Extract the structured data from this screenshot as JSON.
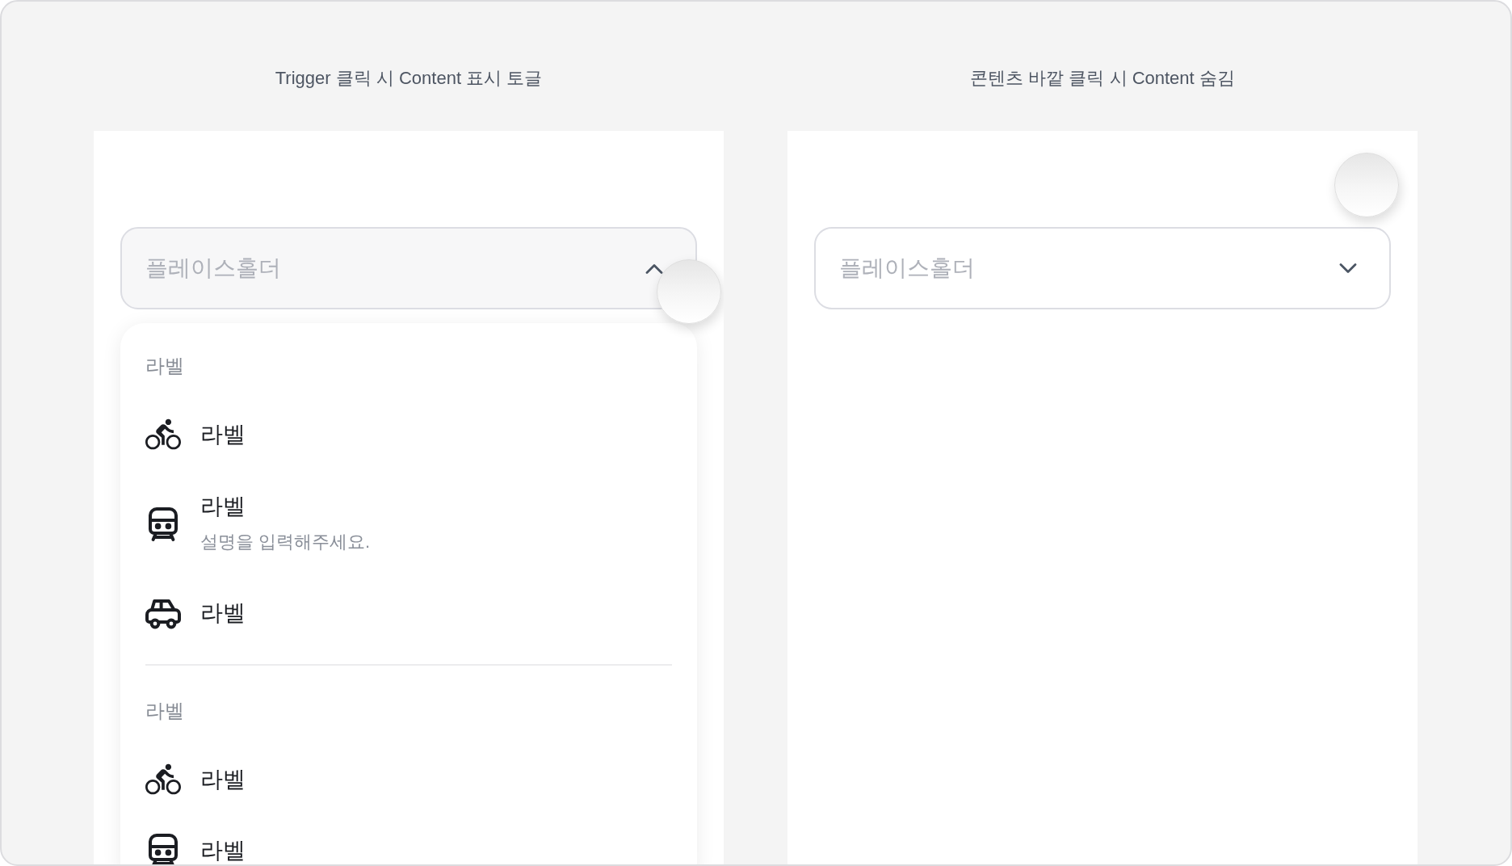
{
  "demos": [
    {
      "title": "Trigger 클릭 시 Content 표시 토글",
      "touch": {
        "kind": "trigger"
      },
      "select": {
        "placeholder": "플레이스홀더",
        "expanded": true
      },
      "menu": {
        "groups": [
          {
            "label": "라벨",
            "items": [
              {
                "label": "라벨",
                "selected": false
              },
              {
                "label": "라벨",
                "description": "설명을 입력해주세요.",
                "selected": false
              },
              {
                "label": "라벨",
                "selected": false
              }
            ]
          },
          {
            "label": "라벨",
            "items": [
              {
                "label": "라벨",
                "selected": false
              },
              {
                "label": "라벨",
                "selected": false
              }
            ]
          }
        ]
      }
    },
    {
      "title": "콘텐츠 바깥 클릭 시 Content 숨김",
      "touch": {
        "kind": "outside"
      },
      "select": {
        "placeholder": "플레이스홀더",
        "expanded": false
      }
    }
  ]
}
